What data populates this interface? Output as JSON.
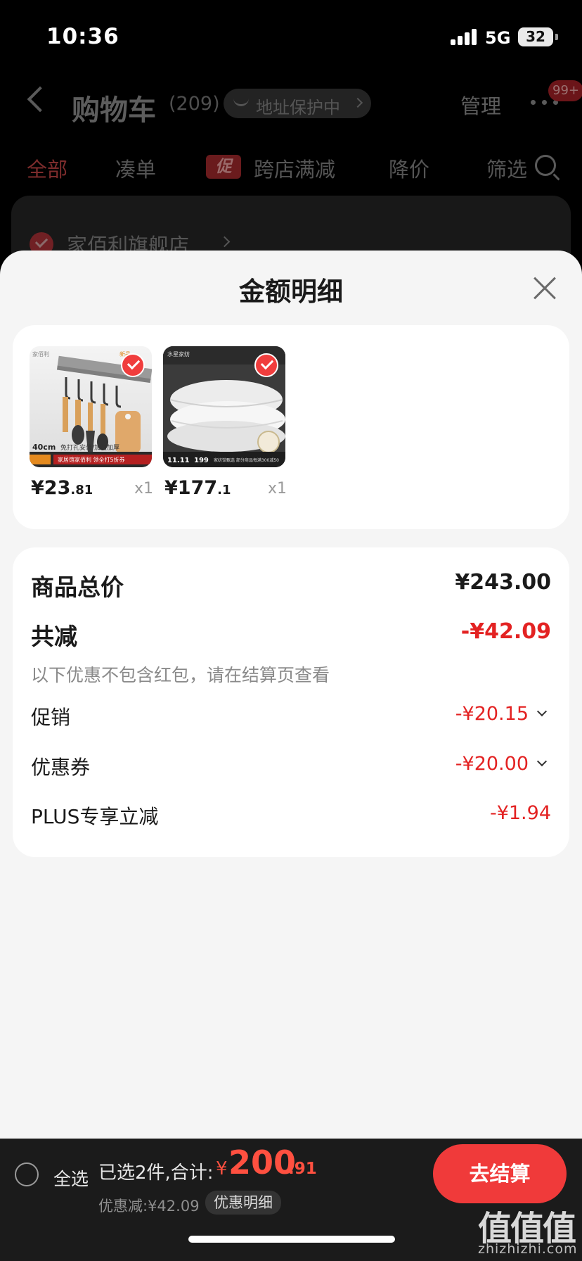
{
  "status_bar": {
    "time": "10:36",
    "network": "5G",
    "battery": "32"
  },
  "cart_header": {
    "title": "购物车",
    "count": "(209)",
    "address_protect": "地址保护中",
    "manage": "管理",
    "badge": "99+"
  },
  "filter_tabs": [
    {
      "label": "全部",
      "active": true
    },
    {
      "label": "凑单"
    },
    {
      "label": "跨店满减",
      "badge": "促"
    },
    {
      "label": "降价"
    },
    {
      "label": "筛选"
    }
  ],
  "store": {
    "name": "家佰利旗舰店"
  },
  "sheet": {
    "title": "金额明细"
  },
  "products": [
    {
      "price_int": "¥23",
      "price_dec": ".81",
      "qty": "x1",
      "image": {
        "brand": "家佰利",
        "tag": "新品",
        "size_text": "40cm",
        "caption": "免打孔安装/加粗加厚",
        "banner": "家居馆家佰利 领全打5折券"
      }
    },
    {
      "price_int": "¥177",
      "price_dec": ".1",
      "qty": "x1",
      "image": {
        "brand": "水星家纺",
        "event": "11.11",
        "price_tag": "199",
        "banner": "家纺馆甄选 部分商品每满300减50"
      }
    }
  ],
  "summary": {
    "total_label": "商品总价",
    "total_value": "¥243.00",
    "reduce_label": "共减",
    "reduce_value": "-¥42.09",
    "note": "以下优惠不包含红包，请在结算页查看",
    "rows": [
      {
        "label": "促销",
        "value": "-¥20.15",
        "expandable": true
      },
      {
        "label": "优惠券",
        "value": "-¥20.00",
        "expandable": true
      },
      {
        "label": "PLUS专享立减",
        "value": "-¥1.94",
        "expandable": false
      }
    ]
  },
  "checkout": {
    "select_all": "全选",
    "selected_text": "已选2件,合计:",
    "total_prefix": "¥",
    "total_int": "200",
    "total_dec": ".91",
    "discount_text": "优惠减:¥42.09",
    "detail_link": "优惠明细",
    "button": "去结算"
  },
  "watermark": {
    "mark": "值值值",
    "domain": "zhizhizhi.com"
  },
  "colors": {
    "accent_red": "#f03a3a",
    "price_red": "#e32222",
    "sheet_bg": "#f5f5f5"
  }
}
